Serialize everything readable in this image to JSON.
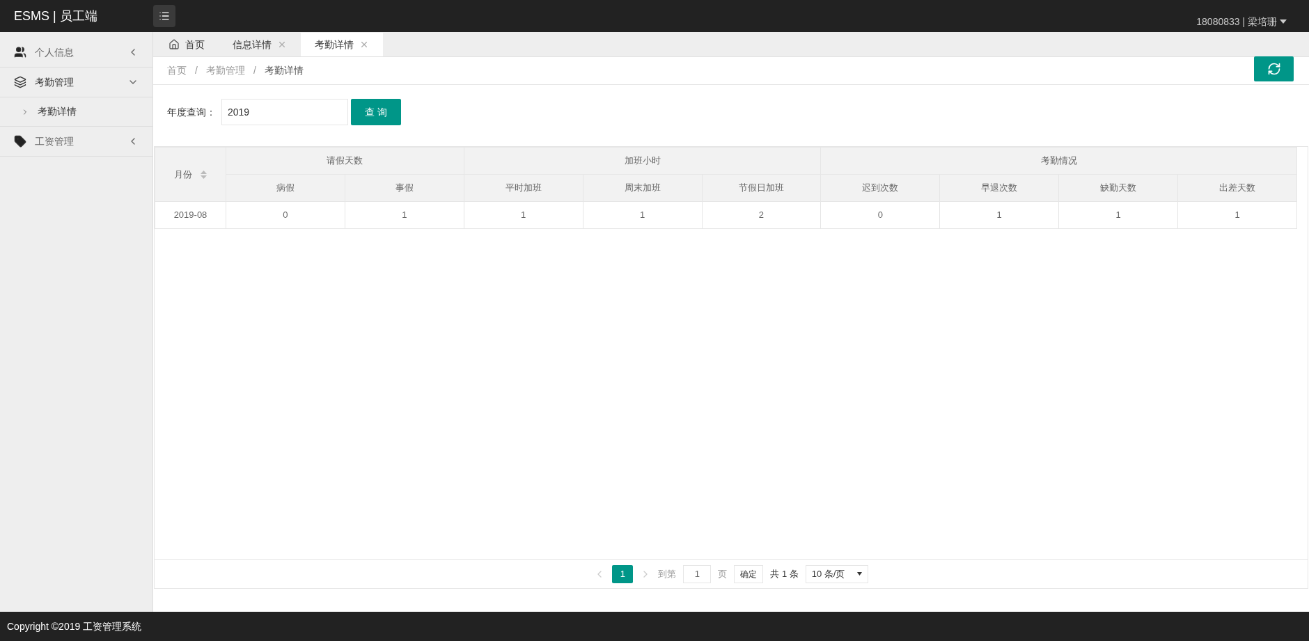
{
  "header": {
    "logo": "ESMS | 员工端",
    "user": "18080833 | 梁培珊"
  },
  "sidebar": {
    "items": [
      {
        "label": "个人信息",
        "kind": "user",
        "expanded": false
      },
      {
        "label": "考勤管理",
        "kind": "layers",
        "expanded": true,
        "children": [
          {
            "label": "考勤详情"
          }
        ]
      },
      {
        "label": "工资管理",
        "kind": "tag",
        "expanded": false
      }
    ]
  },
  "tabs": [
    {
      "label": "首页",
      "kind": "home",
      "selected": false
    },
    {
      "label": "信息详情",
      "kind": "closable",
      "selected": false
    },
    {
      "label": "考勤详情",
      "kind": "closable",
      "selected": true
    }
  ],
  "breadcrumb": [
    {
      "kind": "link",
      "text": "首页"
    },
    {
      "kind": "separator",
      "text": "/"
    },
    {
      "kind": "link",
      "text": "考勤管理"
    },
    {
      "kind": "separator",
      "text": "/"
    },
    {
      "kind": "current",
      "text": "考勤详情"
    }
  ],
  "filter": {
    "label": "年度查询：",
    "value": "2019",
    "button": "查 询"
  },
  "table": {
    "month_column": "月份",
    "groups": [
      {
        "label": "请假天数",
        "columns": [
          "病假",
          "事假"
        ]
      },
      {
        "label": "加班小时",
        "columns": [
          "平时加班",
          "周末加班",
          "节假日加班"
        ]
      },
      {
        "label": "考勤情况",
        "columns": [
          "迟到次数",
          "早退次数",
          "缺勤天数",
          "出差天数"
        ]
      }
    ],
    "rows": [
      [
        "2019-08",
        "0",
        "1",
        "1",
        "1",
        "2",
        "0",
        "1",
        "1",
        "1"
      ]
    ]
  },
  "pagination": {
    "pages": [
      {
        "label": "1",
        "selected": true
      }
    ],
    "goto_label": "到第",
    "page_value": "1",
    "page_unit": "页",
    "confirm": "确定",
    "total": "共 1 条",
    "page_size": "10 条/页"
  },
  "footer": "Copyright ©2019 工资管理系统"
}
